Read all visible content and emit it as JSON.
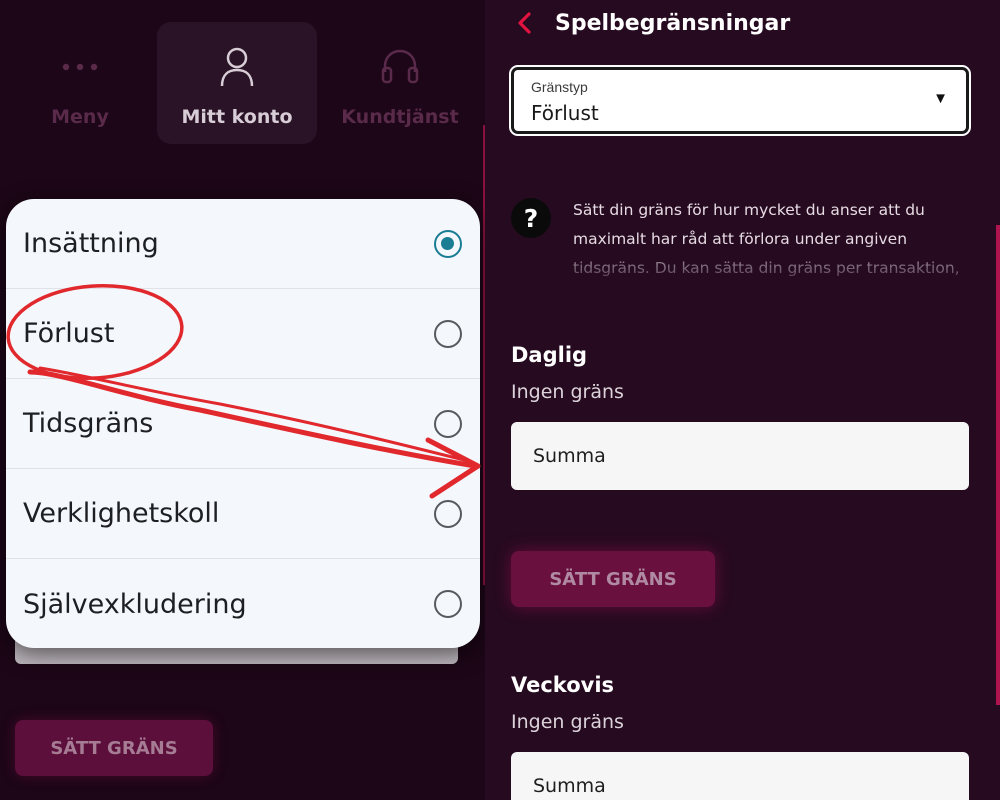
{
  "nav": {
    "items": [
      {
        "label": "Meny",
        "icon": "dots-icon"
      },
      {
        "label": "Mitt konto",
        "icon": "user-icon"
      },
      {
        "label": "Kundtjänst",
        "icon": "headset-icon"
      }
    ]
  },
  "left_background": {
    "button_label": "SÄTT GRÄNS"
  },
  "popup": {
    "options": [
      {
        "label": "Insättning",
        "checked": true
      },
      {
        "label": "Förlust",
        "checked": false
      },
      {
        "label": "Tidsgräns",
        "checked": false
      },
      {
        "label": "Verklighetskoll",
        "checked": false
      },
      {
        "label": "Självexkludering",
        "checked": false
      }
    ]
  },
  "right": {
    "title": "Spelbegränsningar",
    "limit_type": {
      "caption": "Gränstyp",
      "value": "Förlust"
    },
    "info_text": "Sätt din gräns för hur mycket du anser att du maximalt har råd att förlora under angiven tidsgräns. Du kan sätta din gräns per transaktion,",
    "sections": [
      {
        "title": "Daglig",
        "subtitle": "Ingen gräns",
        "placeholder": "Summa"
      },
      {
        "title": "Veckovis",
        "subtitle": "Ingen gräns",
        "placeholder": "Summa"
      }
    ],
    "button_label": "SÄTT GRÄNS"
  },
  "colors": {
    "accent": "#e3133f",
    "radio_selected": "#1a7d93",
    "annotation": "#e0282d"
  }
}
